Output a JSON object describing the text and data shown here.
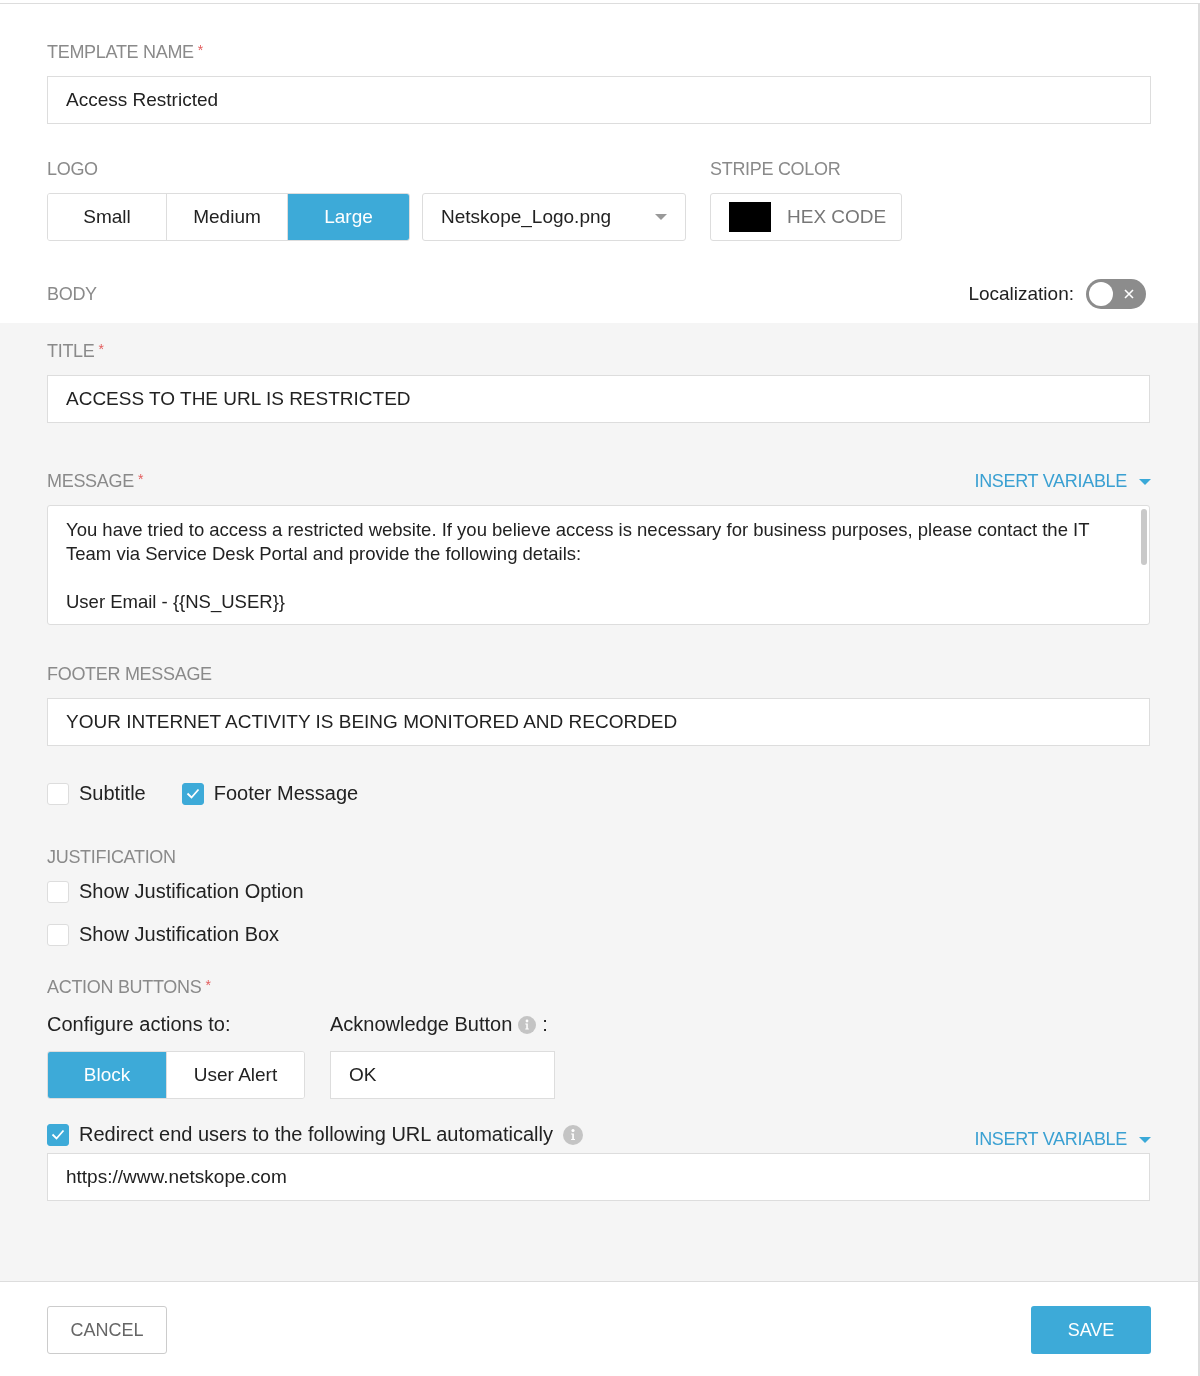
{
  "template_name": {
    "label": "TEMPLATE NAME",
    "required_mark": "*",
    "value": "Access Restricted"
  },
  "logo": {
    "label": "LOGO",
    "sizes": [
      {
        "label": "Small",
        "selected": false
      },
      {
        "label": "Medium",
        "selected": false
      },
      {
        "label": "Large",
        "selected": true
      }
    ],
    "file": "Netskope_Logo.png"
  },
  "stripe_color": {
    "label": "STRIPE COLOR",
    "color": "#000000",
    "placeholder": "HEX CODE"
  },
  "body": {
    "label": "BODY",
    "localization_label": "Localization:",
    "localization_on": false
  },
  "title": {
    "label": "TITLE",
    "required_mark": "*",
    "value": "ACCESS TO THE URL IS RESTRICTED"
  },
  "message": {
    "label": "MESSAGE",
    "required_mark": "*",
    "insert_variable": "INSERT VARIABLE",
    "paragraphs": [
      "You have tried to access a restricted website. If you believe access is necessary for business purposes, please contact the IT Team via Service Desk Portal and provide the following details:",
      "User Email - {{NS_USER}}"
    ]
  },
  "footer_message": {
    "label": "FOOTER MESSAGE",
    "value": "YOUR INTERNET ACTIVITY IS BEING MONITORED AND RECORDED"
  },
  "options": [
    {
      "label": "Subtitle",
      "checked": false
    },
    {
      "label": "Footer Message",
      "checked": true
    }
  ],
  "justification": {
    "label": "JUSTIFICATION",
    "options": [
      {
        "label": "Show Justification Option",
        "checked": false
      },
      {
        "label": "Show Justification Box",
        "checked": false
      }
    ]
  },
  "action_buttons": {
    "label": "ACTION BUTTONS",
    "required_mark": "*",
    "configure_label": "Configure actions to:",
    "actions": [
      {
        "label": "Block",
        "selected": true
      },
      {
        "label": "User Alert",
        "selected": false
      }
    ],
    "acknowledge_label": "Acknowledge Button",
    "acknowledge_suffix": ":",
    "acknowledge_value": "OK"
  },
  "redirect": {
    "label": "Redirect end users to the following URL automatically",
    "checked": true,
    "insert_variable": "INSERT VARIABLE",
    "url": "https://www.netskope.com"
  },
  "buttons": {
    "cancel": "CANCEL",
    "save": "SAVE"
  }
}
